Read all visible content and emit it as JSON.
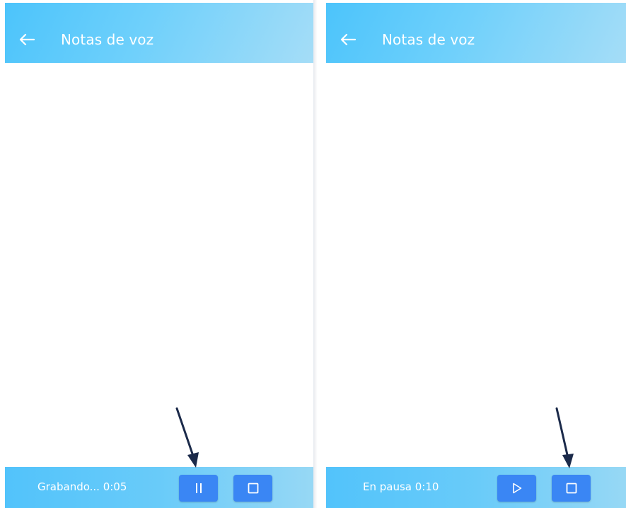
{
  "screens": [
    {
      "header": {
        "title": "Notas de voz",
        "back_icon": "arrow-left-icon"
      },
      "footer": {
        "status_text": "Grabando... 0:05",
        "primary_button_icon": "pause-icon",
        "stop_button_icon": "stop-icon"
      }
    },
    {
      "header": {
        "title": "Notas de voz",
        "back_icon": "arrow-left-icon"
      },
      "footer": {
        "status_text": "En pausa 0:10",
        "primary_button_icon": "play-icon",
        "stop_button_icon": "stop-icon"
      }
    }
  ],
  "colors": {
    "header_gradient_start": "#4cc4fb",
    "header_gradient_end": "#a5ddf7",
    "button_blue": "#3a86f4",
    "annotation_arrow": "#1b2a4a",
    "text_on_blue": "#ffffff"
  }
}
